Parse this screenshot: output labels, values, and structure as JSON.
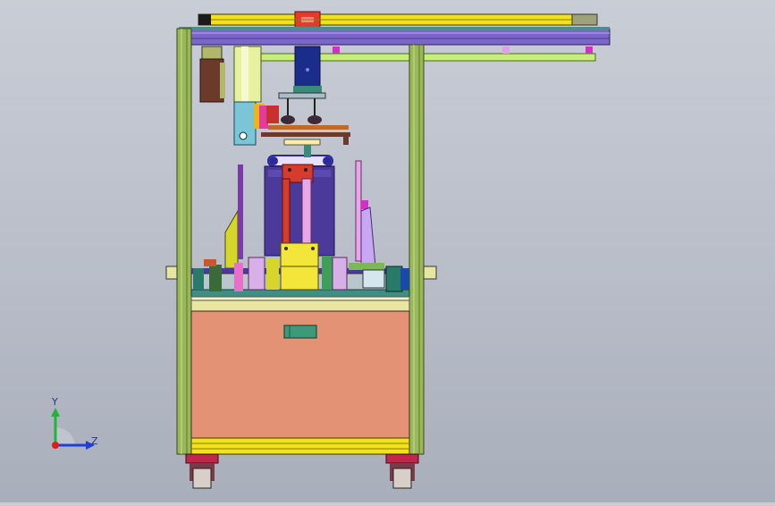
{
  "viewport": {
    "background_top": "#c9cdd6",
    "background_bottom": "#a9aebb",
    "model": "machine-frame-front-view"
  },
  "triad": {
    "y_label": "Y",
    "z_label": "Z",
    "y_color": "#22b33a",
    "z_color": "#1f3fd6",
    "origin_color": "#d61f1f"
  },
  "colors": {
    "frame": "#9ab85a",
    "frame_dark": "#5d7a2a",
    "top_rail": "#f2e21a",
    "purple_beam": "#7a67c8",
    "cabinet": "#e39276",
    "motor_blue": "#1a2d8a",
    "red_block": "#d63b2b",
    "yellow_block": "#f4e53a",
    "violet": "#9c6bd8",
    "teal": "#3f8f86",
    "olive": "#b3b43a",
    "pink": "#e870c8",
    "brown": "#6b3a2a",
    "wheel": "#c0284a"
  }
}
